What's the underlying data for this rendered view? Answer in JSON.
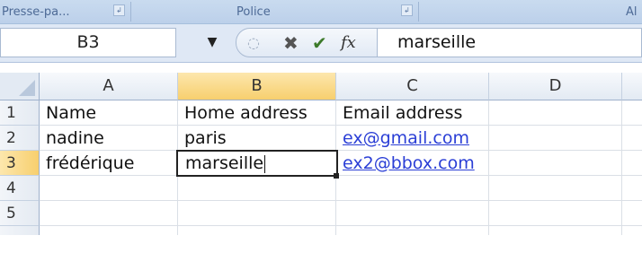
{
  "ribbon": {
    "groups": [
      {
        "label": "Presse-pa...",
        "launcher": "↲"
      },
      {
        "label": "Police",
        "launcher": "↲"
      },
      {
        "label": "Al",
        "launcher": ""
      }
    ]
  },
  "formula_bar": {
    "name_box": "B3",
    "dropdown_icon": "chevron-down-icon",
    "cancel_glyph": "✖",
    "enter_glyph": "✔",
    "function_glyph": "fx",
    "content": "marseille"
  },
  "columns": [
    "A",
    "B",
    "C",
    "D"
  ],
  "active_column": "B",
  "rows": [
    {
      "num": "1",
      "cells": [
        "Name",
        "Home address",
        "Email address",
        ""
      ]
    },
    {
      "num": "2",
      "cells": [
        "nadine",
        "paris",
        "ex@gmail.com",
        ""
      ]
    },
    {
      "num": "3",
      "cells": [
        "frédérique",
        "marseille",
        "ex2@bbox.com",
        ""
      ]
    },
    {
      "num": "4",
      "cells": [
        "",
        "",
        "",
        ""
      ]
    },
    {
      "num": "5",
      "cells": [
        "",
        "",
        "",
        ""
      ]
    }
  ],
  "active_row": "3",
  "link_color": "#2b3fd6",
  "selection_color": "#f7cf6e"
}
